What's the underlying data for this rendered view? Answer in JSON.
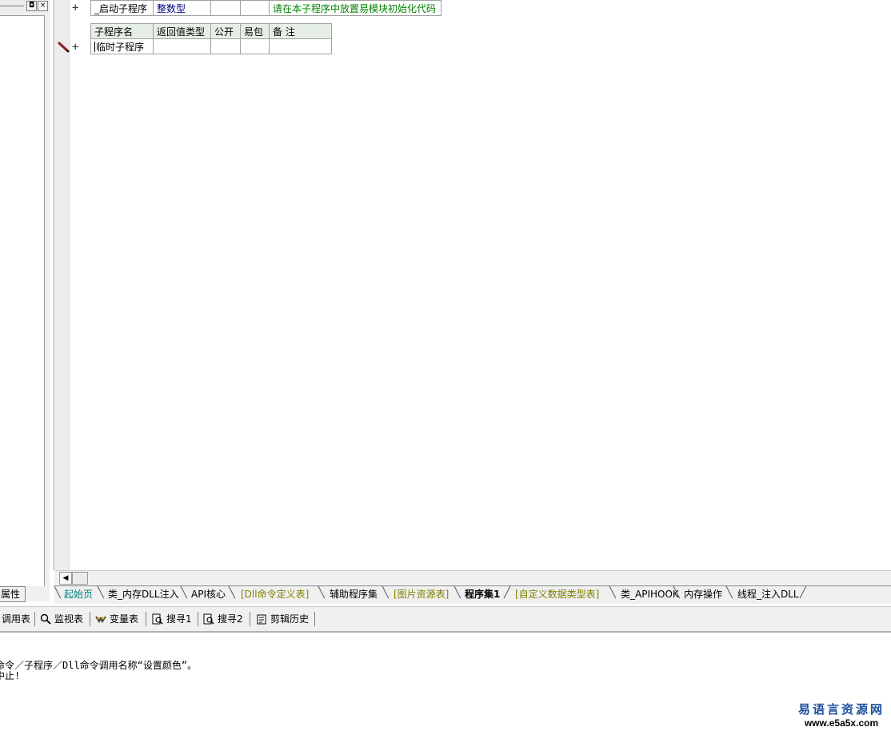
{
  "left_panel": {
    "restore_glyph": "◘",
    "close_glyph": "×",
    "properties_tab": "属性"
  },
  "editor": {
    "top_table": {
      "row": [
        "_启动子程序",
        "整数型",
        "",
        "",
        "请在本子程序中放置易模块初始化代码"
      ]
    },
    "sub_table": {
      "headers": [
        "子程序名",
        "返回值类型",
        "公开",
        "易包",
        "备 注"
      ],
      "row": [
        "临时子程序",
        "",
        "",
        "",
        ""
      ]
    },
    "plus_glyph": "+"
  },
  "tabs": [
    {
      "label": "起始页",
      "style": "teal"
    },
    {
      "label": "类_内存DLL注入",
      "style": "normal"
    },
    {
      "label": "API核心",
      "style": "normal"
    },
    {
      "label": "[Dll命令定义表]",
      "style": "olive"
    },
    {
      "label": "辅助程序集",
      "style": "normal"
    },
    {
      "label": "[图片资源表]",
      "style": "olive"
    },
    {
      "label": "程序集1",
      "style": "active"
    },
    {
      "label": "[自定义数据类型表]",
      "style": "olive"
    },
    {
      "label": "类_APIHOOK",
      "style": "normal"
    },
    {
      "label": "内存操作",
      "style": "normal"
    },
    {
      "label": "线程_注入DLL",
      "style": "normal"
    }
  ],
  "toolbar": {
    "call_table": "调用表",
    "watch": "监视表",
    "variables": "变量表",
    "search1": "搜寻1",
    "search2": "搜寻2",
    "clip_history": "剪辑历史"
  },
  "output": {
    "line1": "命令／子程序／Dll命令调用名称“设置颜色”。",
    "line2": "中止!"
  },
  "watermark": {
    "logo": "易语言资源网",
    "url": "www.e5a5x.com"
  },
  "colors": {
    "table_header_bg": "#e6efe6",
    "type_text": "#000080",
    "comment_text": "#008000",
    "tab_teal": "#008080",
    "tab_olive": "#808000"
  }
}
